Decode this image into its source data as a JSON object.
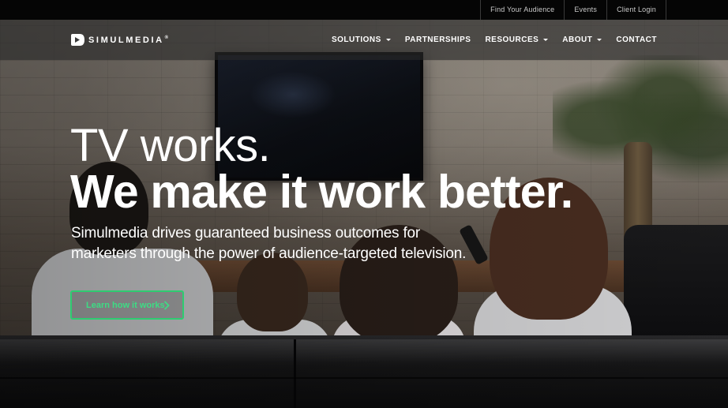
{
  "utility_bar": {
    "links": [
      "Find Your Audience",
      "Events",
      "Client Login"
    ]
  },
  "brand": {
    "name": "SIMULMEDIA",
    "mark": "®"
  },
  "nav": {
    "items": [
      {
        "label": "SOLUTIONS",
        "dropdown": true
      },
      {
        "label": "PARTNERSHIPS",
        "dropdown": false
      },
      {
        "label": "RESOURCES",
        "dropdown": true
      },
      {
        "label": "ABOUT",
        "dropdown": true
      },
      {
        "label": "CONTACT",
        "dropdown": false
      }
    ]
  },
  "hero": {
    "headline_line1": "TV works.",
    "headline_line2": "We make it work better.",
    "subhead": "Simulmedia drives guaranteed business outcomes for marketers through the power of audience-targeted television.",
    "cta_label": "Learn how it works",
    "cta_icon": "chevron-right-icon",
    "background": "family-watching-tv-photo"
  },
  "colors": {
    "accent": "#2ecc71",
    "utility_bg": "#050505",
    "text": "#ffffff"
  }
}
